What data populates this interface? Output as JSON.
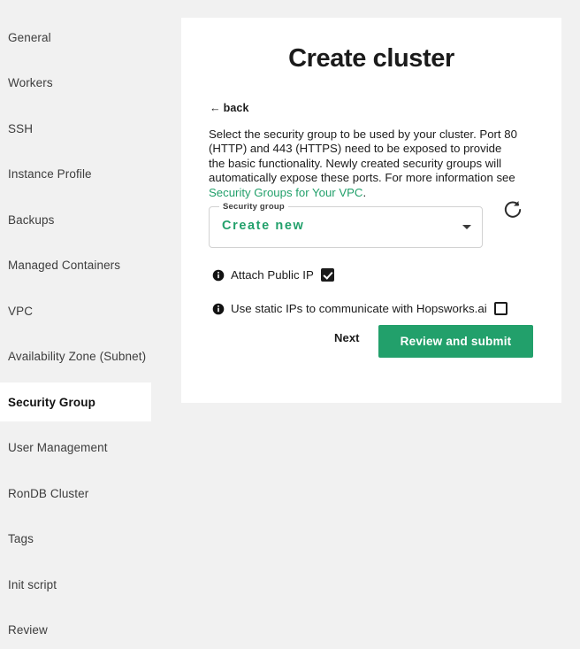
{
  "sidebar": {
    "items": [
      {
        "label": "General",
        "active": false
      },
      {
        "label": "Workers",
        "active": false
      },
      {
        "label": "SSH",
        "active": false
      },
      {
        "label": "Instance Profile",
        "active": false
      },
      {
        "label": "Backups",
        "active": false
      },
      {
        "label": "Managed Containers",
        "active": false
      },
      {
        "label": "VPC",
        "active": false
      },
      {
        "label": "Availability Zone (Subnet)",
        "active": false
      },
      {
        "label": "Security Group",
        "active": true
      },
      {
        "label": "User Management",
        "active": false
      },
      {
        "label": "RonDB Cluster",
        "active": false
      },
      {
        "label": "Tags",
        "active": false
      },
      {
        "label": "Init script",
        "active": false
      },
      {
        "label": "Review",
        "active": false
      }
    ]
  },
  "card": {
    "title": "Create cluster",
    "back_arrow": "←",
    "back_label": "back",
    "description": {
      "text": "Select the security group to be used by your cluster. Port 80 (HTTP) and 443 (HTTPS) need to be exposed to provide the basic functionality. Newly created security groups will automatically expose these ports. For more information see ",
      "link_text": "Security Groups for Your VPC",
      "trailing": "."
    },
    "security_group_select": {
      "legend": "Security group",
      "value": "Create new",
      "caret_icon": "chevron-down-icon",
      "options": [
        "Create new"
      ]
    },
    "refresh_icon": "refresh-icon",
    "options": [
      {
        "info_icon": "info-icon",
        "label": "Attach Public IP",
        "checked": true
      },
      {
        "info_icon": "info-icon",
        "label": "Use static IPs to communicate with Hopsworks.ai",
        "checked": false
      }
    ],
    "actions": {
      "next_label": "Next",
      "submit_label": "Review and submit"
    }
  },
  "colors": {
    "accent_green": "#22a06b",
    "page_background": "#f1f1f1",
    "card_background": "#ffffff",
    "text": "#1b1b1b"
  }
}
